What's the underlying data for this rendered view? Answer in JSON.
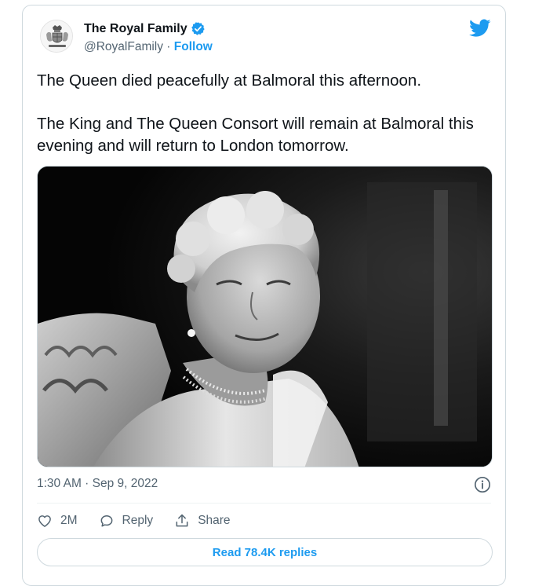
{
  "tweet": {
    "author_name": "The Royal Family",
    "handle": "@RoyalFamily",
    "separator": " · ",
    "follow_label": "Follow",
    "paragraphs": [
      "The Queen died peacefully at Balmoral this afternoon.",
      "The King and The Queen Consort will remain at Balmoral this evening and will return to London tomorrow."
    ],
    "timestamp": "1:30 AM · Sep 9, 2022",
    "likes": "2M",
    "reply_label": "Reply",
    "share_label": "Share",
    "read_replies_label": "Read 78.4K replies"
  },
  "icons": {
    "verified": "verified-badge-icon",
    "brand": "twitter-bird-icon",
    "info": "info-icon",
    "like": "heart-icon",
    "reply": "speech-bubble-icon",
    "share": "share-upload-icon"
  },
  "colors": {
    "accent": "#1d9bf0",
    "text": "#0f1419",
    "secondary": "#536471",
    "border": "#cfd9de"
  }
}
